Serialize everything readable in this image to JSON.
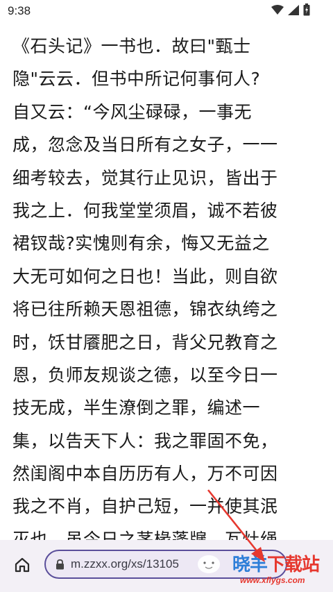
{
  "status_bar": {
    "time": "9:38",
    "icons": [
      "wifi-icon",
      "cellular-signal-icon",
      "battery-charging-icon"
    ]
  },
  "content": {
    "lines": [
      "《石头记》一书也．故曰\"甄士",
      "隐\"云云．但书中所记何事何人?",
      "自又云：“今风尘碌碌，一事无",
      "成，忽念及当日所有之女子，一一",
      "细考较去，觉其行止见识，皆出于",
      "我之上．何我堂堂须眉，诚不若彼",
      "裙钗哉?实愧则有余，悔又无益之",
      "大无可如何之日也！当此，则自欲",
      "将已往所赖天恩祖德，锦衣纨绔之",
      "时，饫甘餍肥之日，背父兄教育之",
      "恩，负师友规谈之德，以至今日一",
      "技无成，半生潦倒之罪，编述一",
      "集，以告天下人：我之罪固不免，",
      "然闺阁中本自历历有人，万不可因",
      "我之不肖，自护己短，一并使其泯",
      "灭也．虽今日之茅椽蓬牖，瓦灶绳"
    ]
  },
  "browser_bar": {
    "url": "m.zzxx.org/xs/13105",
    "home_icon": "home-icon",
    "lock_icon": "lock-icon"
  },
  "watermark": {
    "title_part1": "晓羊",
    "title_part2": "下载站",
    "subtitle": "www.xflygs.com"
  },
  "colors": {
    "accent": "#5a4e9a",
    "bar_bg": "#f3f0f6",
    "arrow": "#e6382f"
  }
}
